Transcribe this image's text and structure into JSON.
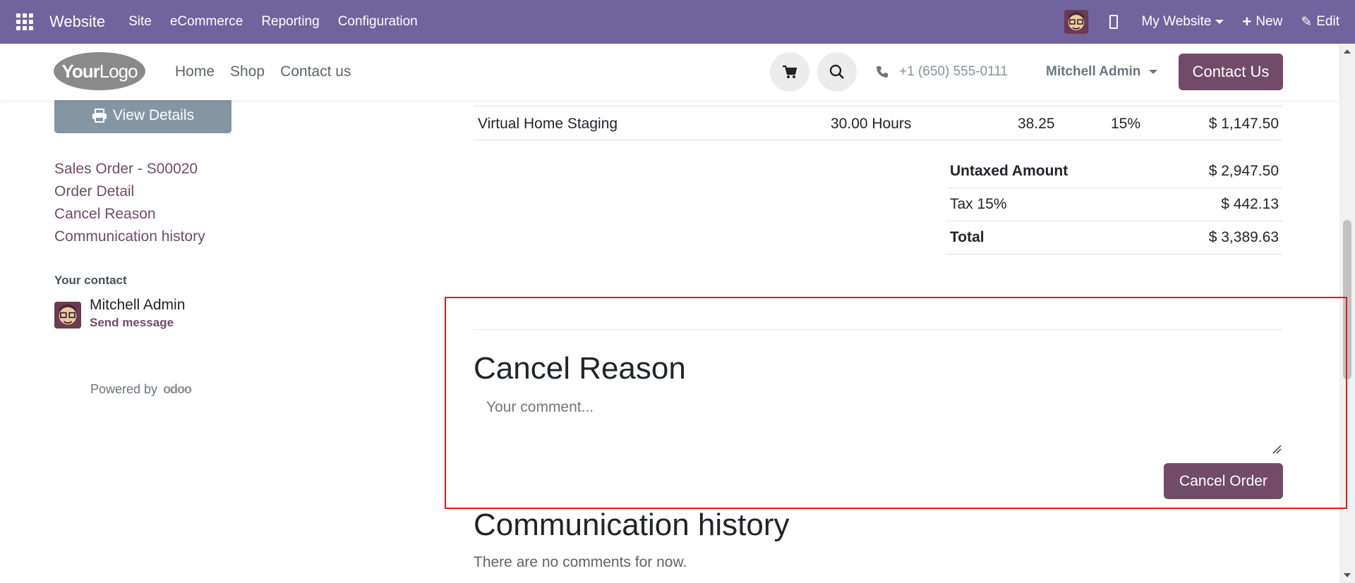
{
  "topbar": {
    "brand": "Website",
    "menu": [
      "Site",
      "eCommerce",
      "Reporting",
      "Configuration"
    ],
    "my_website": "My Website",
    "new_label": "New",
    "edit_label": "Edit"
  },
  "site_header": {
    "logo_bold": "Your",
    "logo_thin": "Logo",
    "nav": [
      "Home",
      "Shop",
      "Contact us"
    ],
    "phone": "+1 (650) 555-0111",
    "user": "Mitchell Admin",
    "contact_button": "Contact Us"
  },
  "sidebar": {
    "view_details": "View Details",
    "links": [
      "Sales Order - S00020",
      "Order Detail",
      "Cancel Reason",
      "Communication history"
    ],
    "your_contact_label": "Your contact",
    "contact_name": "Mitchell Admin",
    "send_message": "Send message",
    "powered_by": "Powered by",
    "odoo": "odoo"
  },
  "order_line": {
    "product": "Virtual Home Staging",
    "quantity": "30.00 Hours",
    "unit_price": "38.25",
    "tax": "15%",
    "amount": "$ 1,147.50"
  },
  "totals": {
    "untaxed_label": "Untaxed Amount",
    "untaxed_value": "$ 2,947.50",
    "tax_label": "Tax 15%",
    "tax_value": "$ 442.13",
    "total_label": "Total",
    "total_value": "$ 3,389.63"
  },
  "cancel": {
    "title": "Cancel Reason",
    "placeholder": "Your comment...",
    "button": "Cancel Order"
  },
  "communication": {
    "title": "Communication history",
    "empty": "There are no comments for now."
  },
  "colors": {
    "topbar": "#71639e",
    "primary": "#714b67",
    "secondary_button": "#8596a3",
    "highlight": "#e01b1b"
  }
}
